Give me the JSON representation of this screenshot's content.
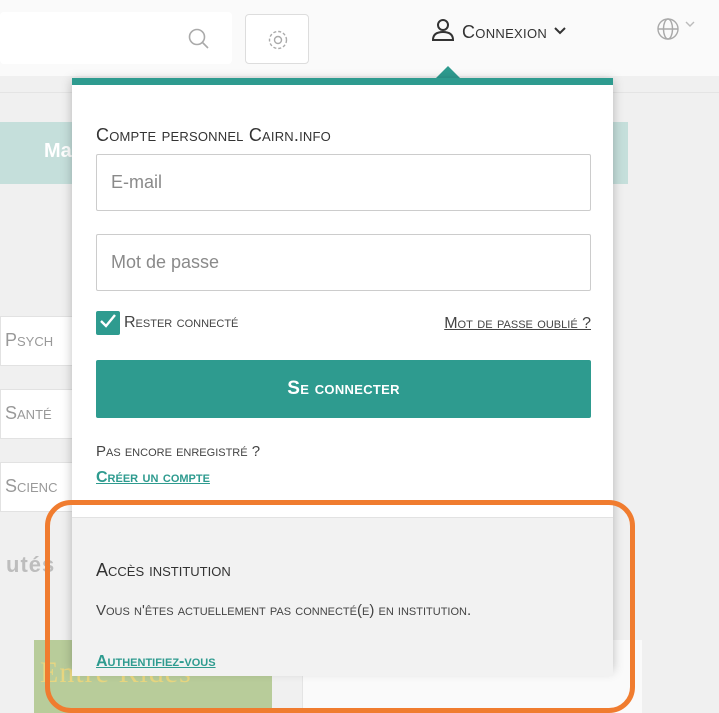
{
  "header": {
    "search_icon": "search-icon",
    "settings_icon": "gear-icon",
    "login_label": "Connexion",
    "language_icon": "globe-icon"
  },
  "background": {
    "tab_fragment": "Ma",
    "categories": [
      "Psych",
      "Santé",
      "Scienc"
    ],
    "section_fragment": "utés",
    "card_fragment": "Entre Rides"
  },
  "login": {
    "title": "Compte personnel Cairn.info",
    "email_placeholder": "E-mail",
    "email_value": "",
    "password_placeholder": "Mot de passe",
    "password_value": "",
    "remember_label": "Rester connecté",
    "remember_checked": true,
    "forgot_link": "Mot de passe oublié ?",
    "submit_label": "Se connecter",
    "register_prompt": "Pas encore enregistré ?",
    "register_link": "Créer un compte"
  },
  "institution": {
    "title": "Accès institution",
    "message": "Vous n'êtes actuellement pas connecté(e) en institution.",
    "auth_link": "Authentifiez-vous"
  },
  "colors": {
    "accent": "#2e9b8f",
    "highlight": "#f07c2f"
  }
}
